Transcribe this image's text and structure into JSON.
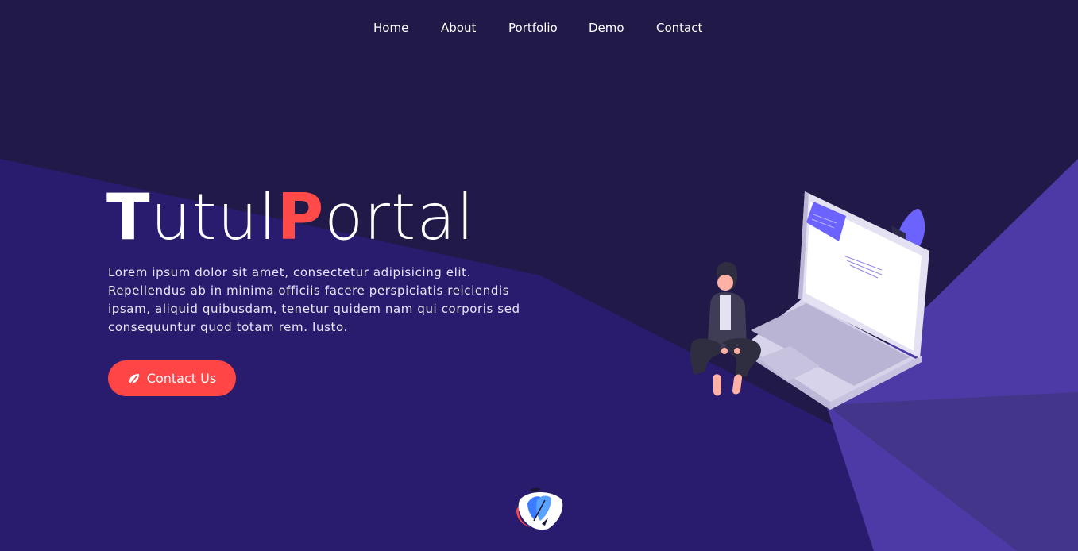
{
  "nav": {
    "items": [
      {
        "label": "Home"
      },
      {
        "label": "About"
      },
      {
        "label": "Portfolio"
      },
      {
        "label": "Demo"
      },
      {
        "label": "Contact"
      }
    ]
  },
  "hero": {
    "brand": {
      "part1_cap": "T",
      "part1_rest": "utul",
      "part2_cap": "P",
      "part2_rest": "ortal"
    },
    "description": "Lorem ipsum dolor sit amet, consectetur adipisicing elit. Repellendus ab in minima officiis facere perspiciatis reiciendis ipsam, aliquid quibusdam, tenetur quidem nam qui corporis sed consequuntur quod totam rem. Iusto.",
    "cta_label": "Contact Us",
    "cta_icon": "leaf-icon"
  },
  "colors": {
    "background": "#211a49",
    "band": "#2a1d6e",
    "accent_red": "#ff4545",
    "accent_purple": "#4e3aa8",
    "illustration_purple": "#6c63ff"
  },
  "footer_logo": "feather-logo-icon"
}
